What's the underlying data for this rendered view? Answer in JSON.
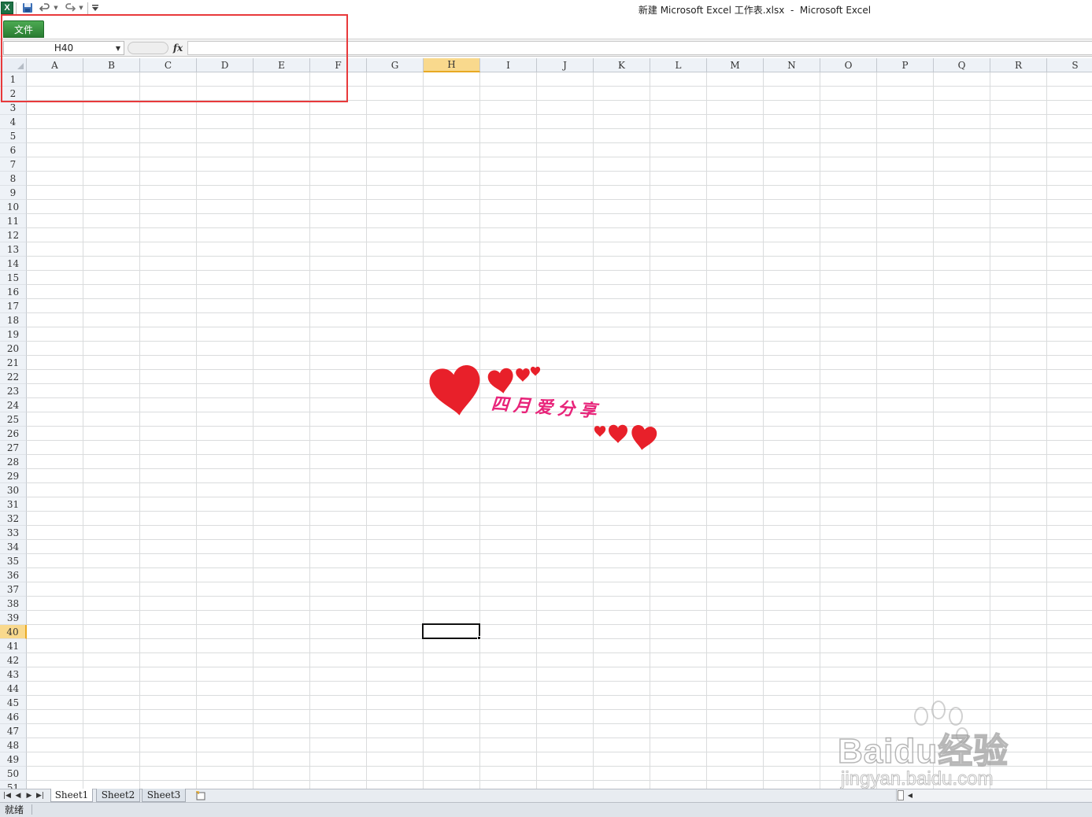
{
  "window": {
    "title": "新建 Microsoft Excel 工作表.xlsx  -  Microsoft Excel",
    "app_icon_letter": "X"
  },
  "quick_access": {
    "save_icon": "save-icon",
    "undo_icon": "undo-icon",
    "redo_icon": "redo-icon",
    "customize_icon": "customize-qat-icon"
  },
  "ribbon": {
    "file_tab_label": "文件"
  },
  "formula_bar": {
    "name_box_value": "H40",
    "fx_label": "fx",
    "formula_value": ""
  },
  "grid": {
    "columns": [
      "A",
      "B",
      "C",
      "D",
      "E",
      "F",
      "G",
      "H",
      "I",
      "J",
      "K",
      "L",
      "M",
      "N",
      "O",
      "P",
      "Q",
      "R",
      "S"
    ],
    "rows": [
      "1",
      "2",
      "3",
      "4",
      "5",
      "6",
      "7",
      "8",
      "9",
      "10",
      "11",
      "12",
      "13",
      "14",
      "15",
      "16",
      "17",
      "18",
      "19",
      "20",
      "21",
      "22",
      "23",
      "24",
      "25",
      "26",
      "27",
      "28",
      "29",
      "30",
      "31",
      "32",
      "33",
      "34",
      "35",
      "36",
      "37",
      "38",
      "39",
      "40",
      "41",
      "42",
      "43",
      "44",
      "45",
      "46",
      "47",
      "48",
      "49",
      "50",
      "51"
    ],
    "active_column": "H",
    "active_row": "40"
  },
  "decoration": {
    "text": "四月爱分享",
    "heart_color": "#e8202a",
    "text_color": "#e8247a"
  },
  "watermark": {
    "brand": "Baidu经验",
    "url": "jingyan.baidu.com"
  },
  "sheets": {
    "tabs": [
      "Sheet1",
      "Sheet2",
      "Sheet3"
    ],
    "active": "Sheet1"
  },
  "status": {
    "text": "就绪"
  },
  "colors": {
    "accent_file_tab": "#2a7d32",
    "highlight_box": "#e8393b",
    "active_header": "#f9d98d"
  }
}
